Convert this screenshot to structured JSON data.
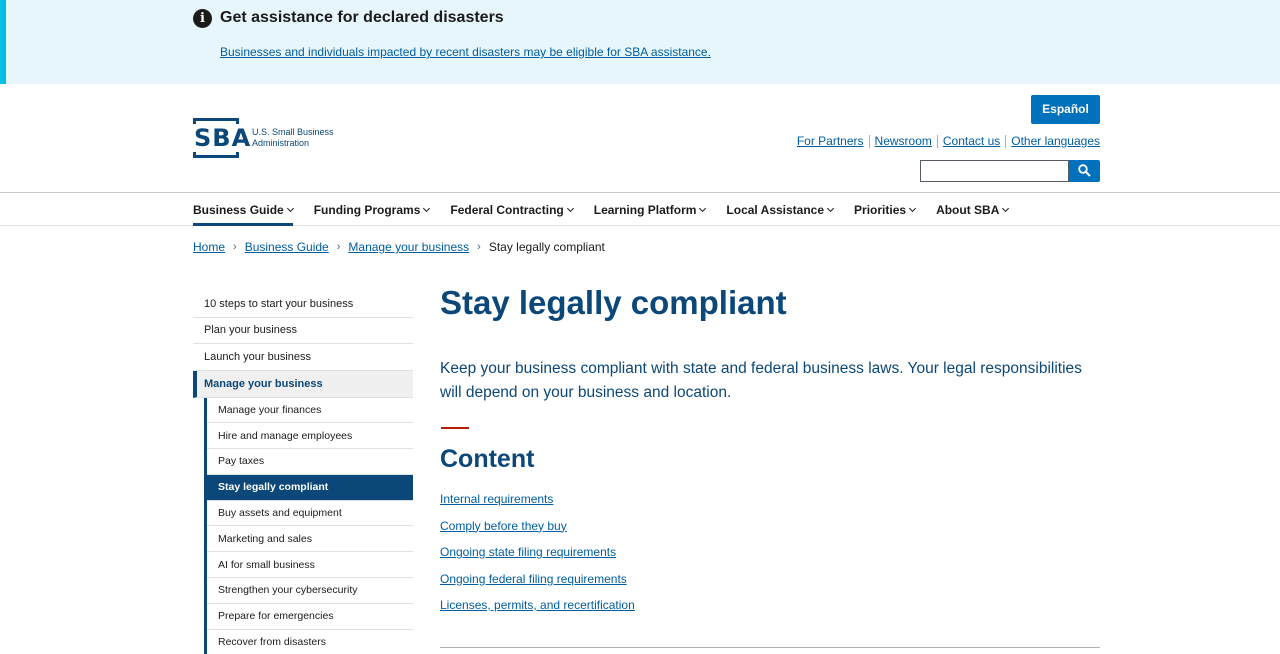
{
  "alert": {
    "title": "Get assistance for declared disasters",
    "link": "Businesses and individuals impacted by recent disasters may be eligible for SBA assistance."
  },
  "header": {
    "logo_text": "SBA",
    "logo_sub": "U.S. Small Business Administration",
    "espanol_label": "Español",
    "util_links": [
      "For Partners",
      "Newsroom",
      "Contact us",
      "Other languages"
    ],
    "search_placeholder": ""
  },
  "nav": {
    "items": [
      "Business Guide",
      "Funding Programs",
      "Federal Contracting",
      "Learning Platform",
      "Local Assistance",
      "Priorities",
      "About SBA"
    ]
  },
  "breadcrumb": {
    "items": [
      "Home",
      "Business Guide",
      "Manage your business"
    ],
    "current": "Stay legally compliant"
  },
  "sidenav": {
    "top_items": [
      "10 steps to start your business",
      "Plan your business",
      "Launch your business"
    ],
    "current_section": "Manage your business",
    "sub_items": [
      "Manage your finances",
      "Hire and manage employees",
      "Pay taxes",
      "Stay legally compliant",
      "Buy assets and equipment",
      "Marketing and sales",
      "AI for small business",
      "Strengthen your cybersecurity",
      "Prepare for emergencies",
      "Recover from disasters"
    ]
  },
  "main": {
    "title": "Stay legally compliant",
    "intro": "Keep your business compliant with state and federal business laws. Your legal responsibilities will depend on your business and location.",
    "content_heading": "Content",
    "toc": [
      "Internal requirements",
      "Comply before they buy",
      "Ongoing state filing requirements",
      "Ongoing federal filing requirements",
      "Licenses, permits, and recertification"
    ]
  },
  "colors": {
    "primary_dark": "#0b4778",
    "link": "#005ea2",
    "button": "#0071bc",
    "alert_bg": "#e7f6fb",
    "alert_bar": "#00bde3",
    "accent_red": "#b51d09"
  }
}
